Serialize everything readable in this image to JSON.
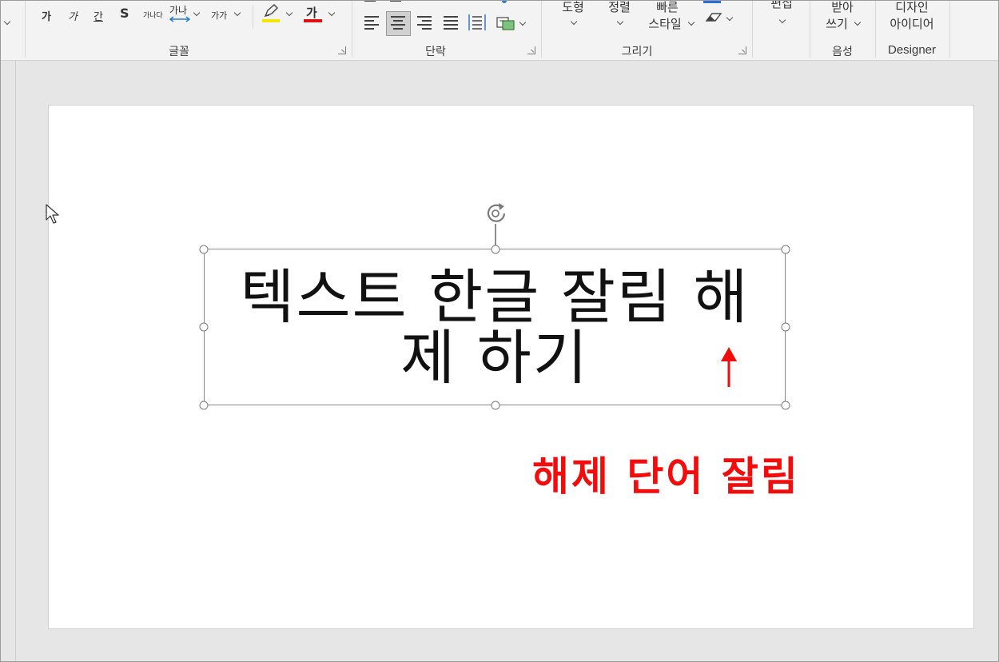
{
  "ribbon": {
    "font_group": {
      "label": "글꼴",
      "bold": "가",
      "italic": "가",
      "underline": "간",
      "strike": "S",
      "shadow": "가나다",
      "spacing": "가나",
      "case": "가가",
      "font_color_glyph": "가"
    },
    "paragraph_group": {
      "label": "단락"
    },
    "drawing_group": {
      "label": "그리기",
      "shapes": "도형",
      "arrange": "정렬",
      "quick_styles_line1": "빠른",
      "quick_styles_line2": "스타일"
    },
    "editing_group": {
      "label": "편집"
    },
    "voice_group": {
      "label": "음성",
      "dictate_line1": "받아",
      "dictate_line2": "쓰기"
    },
    "designer_group": {
      "label": "Designer",
      "ideas_line1": "디자인",
      "ideas_line2": "아이디어"
    }
  },
  "colors": {
    "highlight": "#f5e600",
    "font_color": "#e01010",
    "annotation": "#f20c0c"
  },
  "slide": {
    "textbox_text": "텍스트 한글 잘림 해제 하기",
    "annotation": "해제 단어 잘림"
  }
}
